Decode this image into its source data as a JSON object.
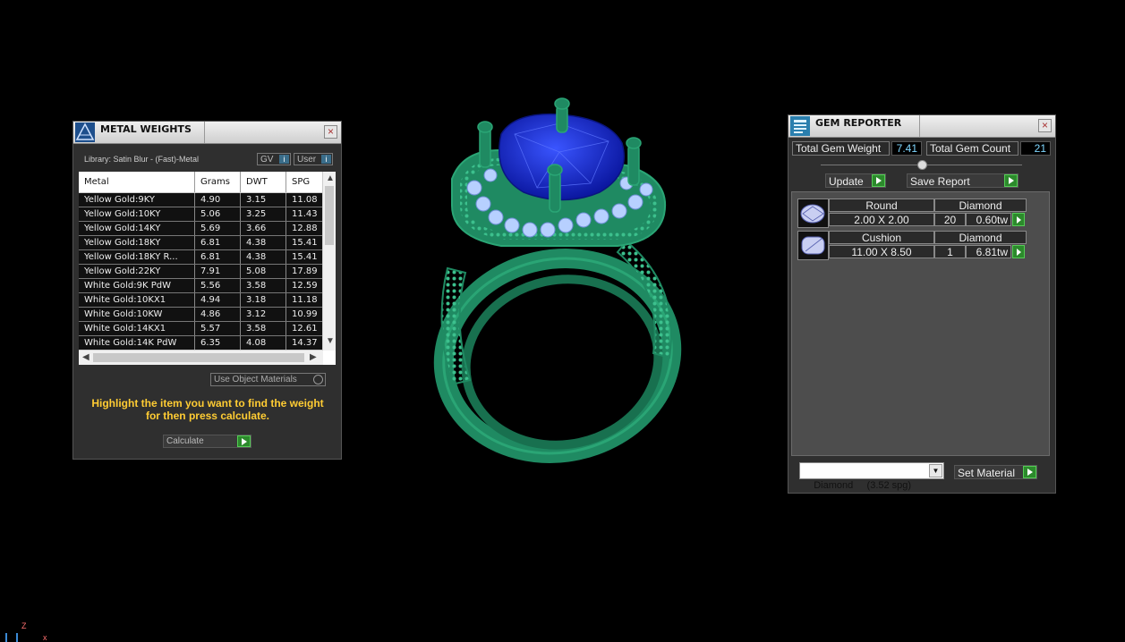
{
  "metal_weights": {
    "title": "METAL WEIGHTS",
    "library": "Library: Satin Blur - (Fast)-Metal",
    "gv_label": "GV",
    "user_label": "User",
    "columns": [
      "Metal",
      "Grams",
      "DWT",
      "SPG"
    ],
    "rows": [
      {
        "metal": "Yellow Gold:9KY",
        "grams": "4.90",
        "dwt": "3.15",
        "spg": "11.08"
      },
      {
        "metal": "Yellow Gold:10KY",
        "grams": "5.06",
        "dwt": "3.25",
        "spg": "11.43"
      },
      {
        "metal": "Yellow Gold:14KY",
        "grams": "5.69",
        "dwt": "3.66",
        "spg": "12.88"
      },
      {
        "metal": "Yellow Gold:18KY",
        "grams": "6.81",
        "dwt": "4.38",
        "spg": "15.41"
      },
      {
        "metal": "Yellow Gold:18KY R...",
        "grams": "6.81",
        "dwt": "4.38",
        "spg": "15.41"
      },
      {
        "metal": "Yellow Gold:22KY",
        "grams": "7.91",
        "dwt": "5.08",
        "spg": "17.89"
      },
      {
        "metal": "White Gold:9K PdW",
        "grams": "5.56",
        "dwt": "3.58",
        "spg": "12.59"
      },
      {
        "metal": "White Gold:10KX1",
        "grams": "4.94",
        "dwt": "3.18",
        "spg": "11.18"
      },
      {
        "metal": "White Gold:10KW",
        "grams": "4.86",
        "dwt": "3.12",
        "spg": "10.99"
      },
      {
        "metal": "White Gold:14KX1",
        "grams": "5.57",
        "dwt": "3.58",
        "spg": "12.61"
      },
      {
        "metal": "White Gold:14K PdW",
        "grams": "6.35",
        "dwt": "4.08",
        "spg": "14.37"
      }
    ],
    "use_object_materials": "Use Object Materials",
    "hint": "Highlight the item you want to find the weight for then press calculate.",
    "calculate_label": "Calculate"
  },
  "gem_reporter": {
    "title": "GEM REPORTER",
    "total_weight_label": "Total Gem Weight",
    "total_weight_value": "7.41",
    "total_count_label": "Total Gem Count",
    "total_count_value": "21",
    "update_label": "Update",
    "save_report_label": "Save Report",
    "gems": [
      {
        "shape": "Round",
        "material": "Diamond",
        "size": "2.00 X 2.00",
        "count": "20",
        "weight": "0.60tw"
      },
      {
        "shape": "Cushion",
        "material": "Diamond",
        "size": "11.00 X 8.50",
        "count": "1",
        "weight": "6.81tw"
      }
    ],
    "material_select": "Diamond     (3.52 spg)",
    "set_material_label": "Set Material"
  },
  "viewport": {
    "axis_z": "Z",
    "axis_x": "x"
  },
  "colors": {
    "metal_green": "#1f8a62",
    "center_stone": "#1a2fc8",
    "accent_stones": "#b7d0ff",
    "hint_text": "#ffcc33",
    "value_text": "#7fd7ff",
    "button_green": "#2c8a2c"
  }
}
